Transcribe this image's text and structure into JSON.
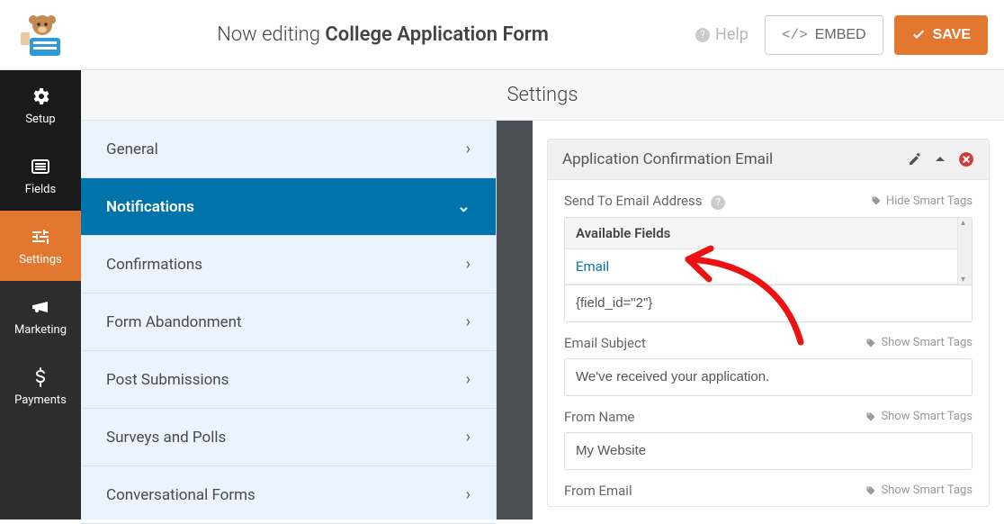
{
  "header": {
    "editing_prefix": "Now editing",
    "form_name": "College Application Form",
    "help": "Help",
    "embed": "EMBED",
    "save": "SAVE"
  },
  "nav": {
    "setup": "Setup",
    "fields": "Fields",
    "settings": "Settings",
    "marketing": "Marketing",
    "payments": "Payments"
  },
  "settings_title": "Settings",
  "sub": {
    "general": "General",
    "notifications": "Notifications",
    "confirmations": "Confirmations",
    "abandonment": "Form Abandonment",
    "post_submissions": "Post Submissions",
    "surveys": "Surveys and Polls",
    "conversational": "Conversational Forms"
  },
  "panel": {
    "title": "Application Confirmation Email",
    "send_to_label": "Send To Email Address",
    "hide_tags": "Hide Smart Tags",
    "show_tags": "Show Smart Tags",
    "available_fields": "Available Fields",
    "avail_email": "Email",
    "send_to_value": "{field_id=\"2\"}",
    "subject_label": "Email Subject",
    "subject_value": "We've received your application.",
    "from_name_label": "From Name",
    "from_name_value": "My Website",
    "from_email_label": "From Email"
  }
}
